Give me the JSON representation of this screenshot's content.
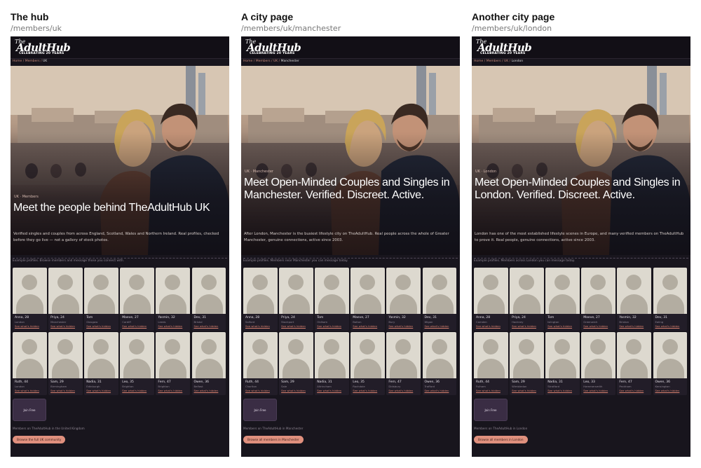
{
  "panels": [
    {
      "title": "The hub",
      "path": "/members/uk",
      "logo": {
        "top": "The",
        "main": "AdultHub",
        "tag": "CELEBRATING 20 YEARS"
      },
      "crumbs": [
        "Home",
        "Members"
      ],
      "crumb_current": "UK",
      "hero": {
        "eyebrow": "UK · Members",
        "heading": "Meet the people behind TheAdultHub UK",
        "sub": "Verified singles and couples from across England, Scotland, Wales and Northern Ireland. Real profiles, checked before they go live — not a gallery of stock photos."
      },
      "note": "Example profiles. Browse members and message those you connect with.",
      "members": [
        {
          "name": "Anna, 28",
          "city": "London",
          "link": "See what's hidden"
        },
        {
          "name": "Priya, 24",
          "city": "Manchester",
          "link": "See what's hidden"
        },
        {
          "name": "Tom",
          "city": "Glasgow",
          "link": "See what's hidden"
        },
        {
          "name": "Maeve, 27",
          "city": "Cardiff",
          "link": "See what's hidden"
        },
        {
          "name": "Yasmin, 32",
          "city": "Leeds",
          "link": "See what's hidden"
        },
        {
          "name": "Dev, 31",
          "city": "Bristol",
          "link": "See what's hidden"
        },
        {
          "name": "Ruth, 44",
          "city": "London",
          "link": "See what's hidden"
        },
        {
          "name": "Sam, 29",
          "city": "Birmingham",
          "link": "See what's hidden"
        },
        {
          "name": "Nadia, 31",
          "city": "Edinburgh",
          "link": "See what's hidden"
        },
        {
          "name": "Leo, 35",
          "city": "Brighton",
          "link": "See what's hidden"
        },
        {
          "name": "Fern, 47",
          "city": "Brighton",
          "link": "See what's hidden"
        },
        {
          "name": "Owen, 36",
          "city": "Belfast",
          "link": "See what's hidden"
        }
      ],
      "join": "Join Free",
      "footer": "Members on TheAdultHub in the United Kingdom",
      "cta": "Browse the full UK community"
    },
    {
      "title": "A city page",
      "path": "/members/uk/manchester",
      "logo": {
        "top": "The",
        "main": "AdultHub",
        "tag": "CELEBRATING 20 YEARS"
      },
      "crumbs": [
        "Home",
        "Members",
        "UK"
      ],
      "crumb_current": "Manchester",
      "hero": {
        "eyebrow": "UK · Manchester",
        "heading": "Meet Open-Minded Couples and Singles in Manchester. Verified. Discreet. Active.",
        "sub": "After London, Manchester is the busiest lifestyle city on TheAdultHub. Real people across the whole of Greater Manchester, genuine connections, active since 2003."
      },
      "note": "Example profiles. Members near Manchester you can message today.",
      "members": [
        {
          "name": "Anna, 28",
          "city": "Salford",
          "link": "See what's hidden"
        },
        {
          "name": "Priya, 24",
          "city": "Stockport",
          "link": "See what's hidden"
        },
        {
          "name": "Tom",
          "city": "Oldham",
          "link": "See what's hidden"
        },
        {
          "name": "Maeve, 27",
          "city": "Bolton",
          "link": "See what's hidden"
        },
        {
          "name": "Yasmin, 32",
          "city": "Bury",
          "link": "See what's hidden"
        },
        {
          "name": "Dev, 31",
          "city": "Wigan",
          "link": "See what's hidden"
        },
        {
          "name": "Ruth, 44",
          "city": "Chorlton",
          "link": "See what's hidden"
        },
        {
          "name": "Sam, 29",
          "city": "Sale",
          "link": "See what's hidden"
        },
        {
          "name": "Nadia, 31",
          "city": "Altrincham",
          "link": "See what's hidden"
        },
        {
          "name": "Leo, 35",
          "city": "Rochdale",
          "link": "See what's hidden"
        },
        {
          "name": "Fern, 47",
          "city": "Didsbury",
          "link": "See what's hidden"
        },
        {
          "name": "Owen, 36",
          "city": "Trafford",
          "link": "See what's hidden"
        }
      ],
      "join": "Join Free",
      "footer": "Members on TheAdultHub in Manchester",
      "cta": "Browse all members in Manchester"
    },
    {
      "title": "Another city page",
      "path": "/members/uk/london",
      "logo": {
        "top": "The",
        "main": "AdultHub",
        "tag": "CELEBRATING 20 YEARS"
      },
      "crumbs": [
        "Home",
        "Members",
        "UK"
      ],
      "crumb_current": "London",
      "hero": {
        "eyebrow": "UK · London",
        "heading": "Meet Open-Minded Couples and Singles in London. Verified. Discreet. Active.",
        "sub": "London has one of the most established lifestyle scenes in Europe, and many verified members on TheAdultHub to prove it. Real people, genuine connections, active since 2003."
      },
      "note": "Example profiles. Members across London you can message today.",
      "members": [
        {
          "name": "Anna, 28",
          "city": "Camden",
          "link": "See what's hidden"
        },
        {
          "name": "Priya, 24",
          "city": "Hackney",
          "link": "See what's hidden"
        },
        {
          "name": "Tom",
          "city": "Islington",
          "link": "See what's hidden"
        },
        {
          "name": "Maeve, 27",
          "city": "Greenwich",
          "link": "See what's hidden"
        },
        {
          "name": "Yasmin, 32",
          "city": "Brixton",
          "link": "See what's hidden"
        },
        {
          "name": "Dev, 31",
          "city": "Ealing",
          "link": "See what's hidden"
        },
        {
          "name": "Ruth, 44",
          "city": "Fulham",
          "link": "See what's hidden"
        },
        {
          "name": "Sam, 29",
          "city": "Wimbledon",
          "link": "See what's hidden"
        },
        {
          "name": "Nadia, 31",
          "city": "Stratford",
          "link": "See what's hidden"
        },
        {
          "name": "Leo, 33",
          "city": "Hammersmith",
          "link": "See what's hidden"
        },
        {
          "name": "Fern, 47",
          "city": "Peckham",
          "link": "See what's hidden"
        },
        {
          "name": "Owen, 36",
          "city": "Kensington",
          "link": "See what's hidden"
        }
      ],
      "join": "Join Free",
      "footer": "Members on TheAdultHub in London",
      "cta": "Browse all members in London"
    }
  ]
}
